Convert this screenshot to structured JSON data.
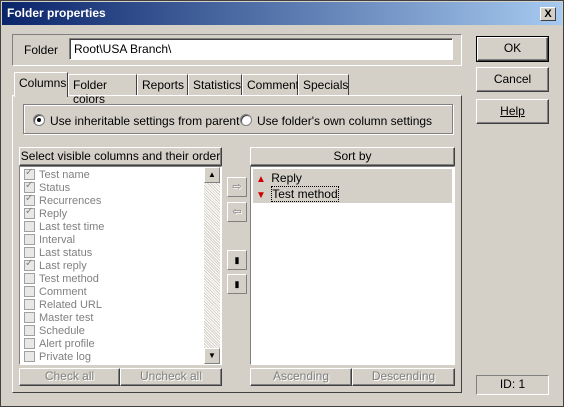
{
  "window": {
    "title": "Folder properties",
    "close_glyph": "X"
  },
  "folder": {
    "label": "Folder",
    "value": "Root\\USA Branch\\"
  },
  "buttons": {
    "ok": "OK",
    "cancel": "Cancel",
    "help": "Help"
  },
  "tabs": [
    {
      "label": "Columns",
      "active": true
    },
    {
      "label": "Folder colors"
    },
    {
      "label": "Reports"
    },
    {
      "label": "Statistics"
    },
    {
      "label": "Comment"
    },
    {
      "label": "Specials"
    }
  ],
  "column_settings": {
    "option_parent": "Use inheritable settings from parent",
    "option_own": "Use folder's own column settings",
    "selected": "parent"
  },
  "visible_columns": {
    "header": "Select visible columns and their order",
    "items": [
      {
        "label": "Test name",
        "checked": true
      },
      {
        "label": "Status",
        "checked": true
      },
      {
        "label": "Recurrences",
        "checked": true
      },
      {
        "label": "Reply",
        "checked": true
      },
      {
        "label": "Last test time",
        "checked": false
      },
      {
        "label": "Interval",
        "checked": false
      },
      {
        "label": "Last status",
        "checked": false
      },
      {
        "label": "Last reply",
        "checked": true
      },
      {
        "label": "Test method",
        "checked": false
      },
      {
        "label": "Comment",
        "checked": false
      },
      {
        "label": "Related URL",
        "checked": false
      },
      {
        "label": "Master test",
        "checked": false
      },
      {
        "label": "Schedule",
        "checked": false
      },
      {
        "label": "Alert profile",
        "checked": false
      },
      {
        "label": "Private log",
        "checked": false
      }
    ],
    "check_all": "Check all",
    "uncheck_all": "Uncheck all"
  },
  "sort_by": {
    "header": "Sort by",
    "items": [
      {
        "label": "Reply",
        "direction": "ascending",
        "color": "#cc0000"
      },
      {
        "label": "Test method",
        "direction": "descending",
        "color": "#cc0000"
      }
    ],
    "ascending": "Ascending",
    "descending": "Descending"
  },
  "status": {
    "id": "ID: 1"
  },
  "colors": {
    "titlebar_start": "#0a246a",
    "titlebar_end": "#a6caf0",
    "face": "#d4d0c8",
    "selection": "#d4d0c8"
  }
}
